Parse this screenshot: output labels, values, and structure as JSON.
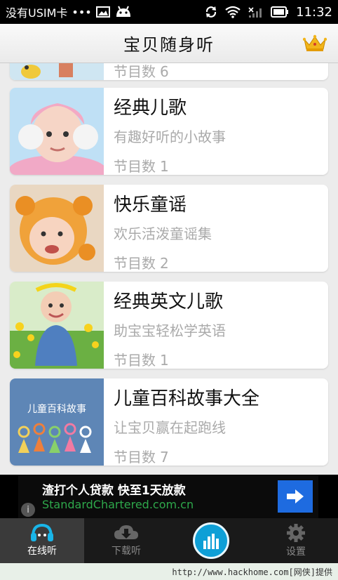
{
  "status_bar": {
    "carrier": "没有USIM卡",
    "dots": "•••",
    "time": "11:32"
  },
  "header": {
    "title": "宝贝随身听",
    "crown_icon": "crown-icon",
    "crown_color": "#f2b51b"
  },
  "list": {
    "count_label": "节目数",
    "partial_item": {
      "count": "6"
    },
    "items": [
      {
        "title": "经典儿歌",
        "desc": "有趣好听的小故事",
        "count": "1"
      },
      {
        "title": "快乐童谣",
        "desc": "欢乐活泼童谣集",
        "count": "2"
      },
      {
        "title": "经典英文儿歌",
        "desc": "助宝宝轻松学英语",
        "count": "1"
      },
      {
        "title": "儿童百科故事大全",
        "desc": "让宝贝赢在起跑线",
        "count": "7"
      }
    ],
    "thumb4_text": "儿童百科故事"
  },
  "ad": {
    "title": "渣打个人贷款 快至1天放款",
    "url": "StandardChartered.com.cn",
    "info": "i",
    "button_color": "#1e6be0"
  },
  "tabs": [
    {
      "label": "在线听",
      "icon": "headphones-icon",
      "active": true
    },
    {
      "label": "下载听",
      "icon": "download-cloud-icon",
      "active": false
    },
    {
      "label": "",
      "icon": "equalizer-icon",
      "active": false
    },
    {
      "label": "设置",
      "icon": "gear-icon",
      "active": false
    }
  ],
  "accent_color": "#0e9fd6",
  "footer": {
    "text": "http://www.hackhome.com[网侠]提供"
  }
}
